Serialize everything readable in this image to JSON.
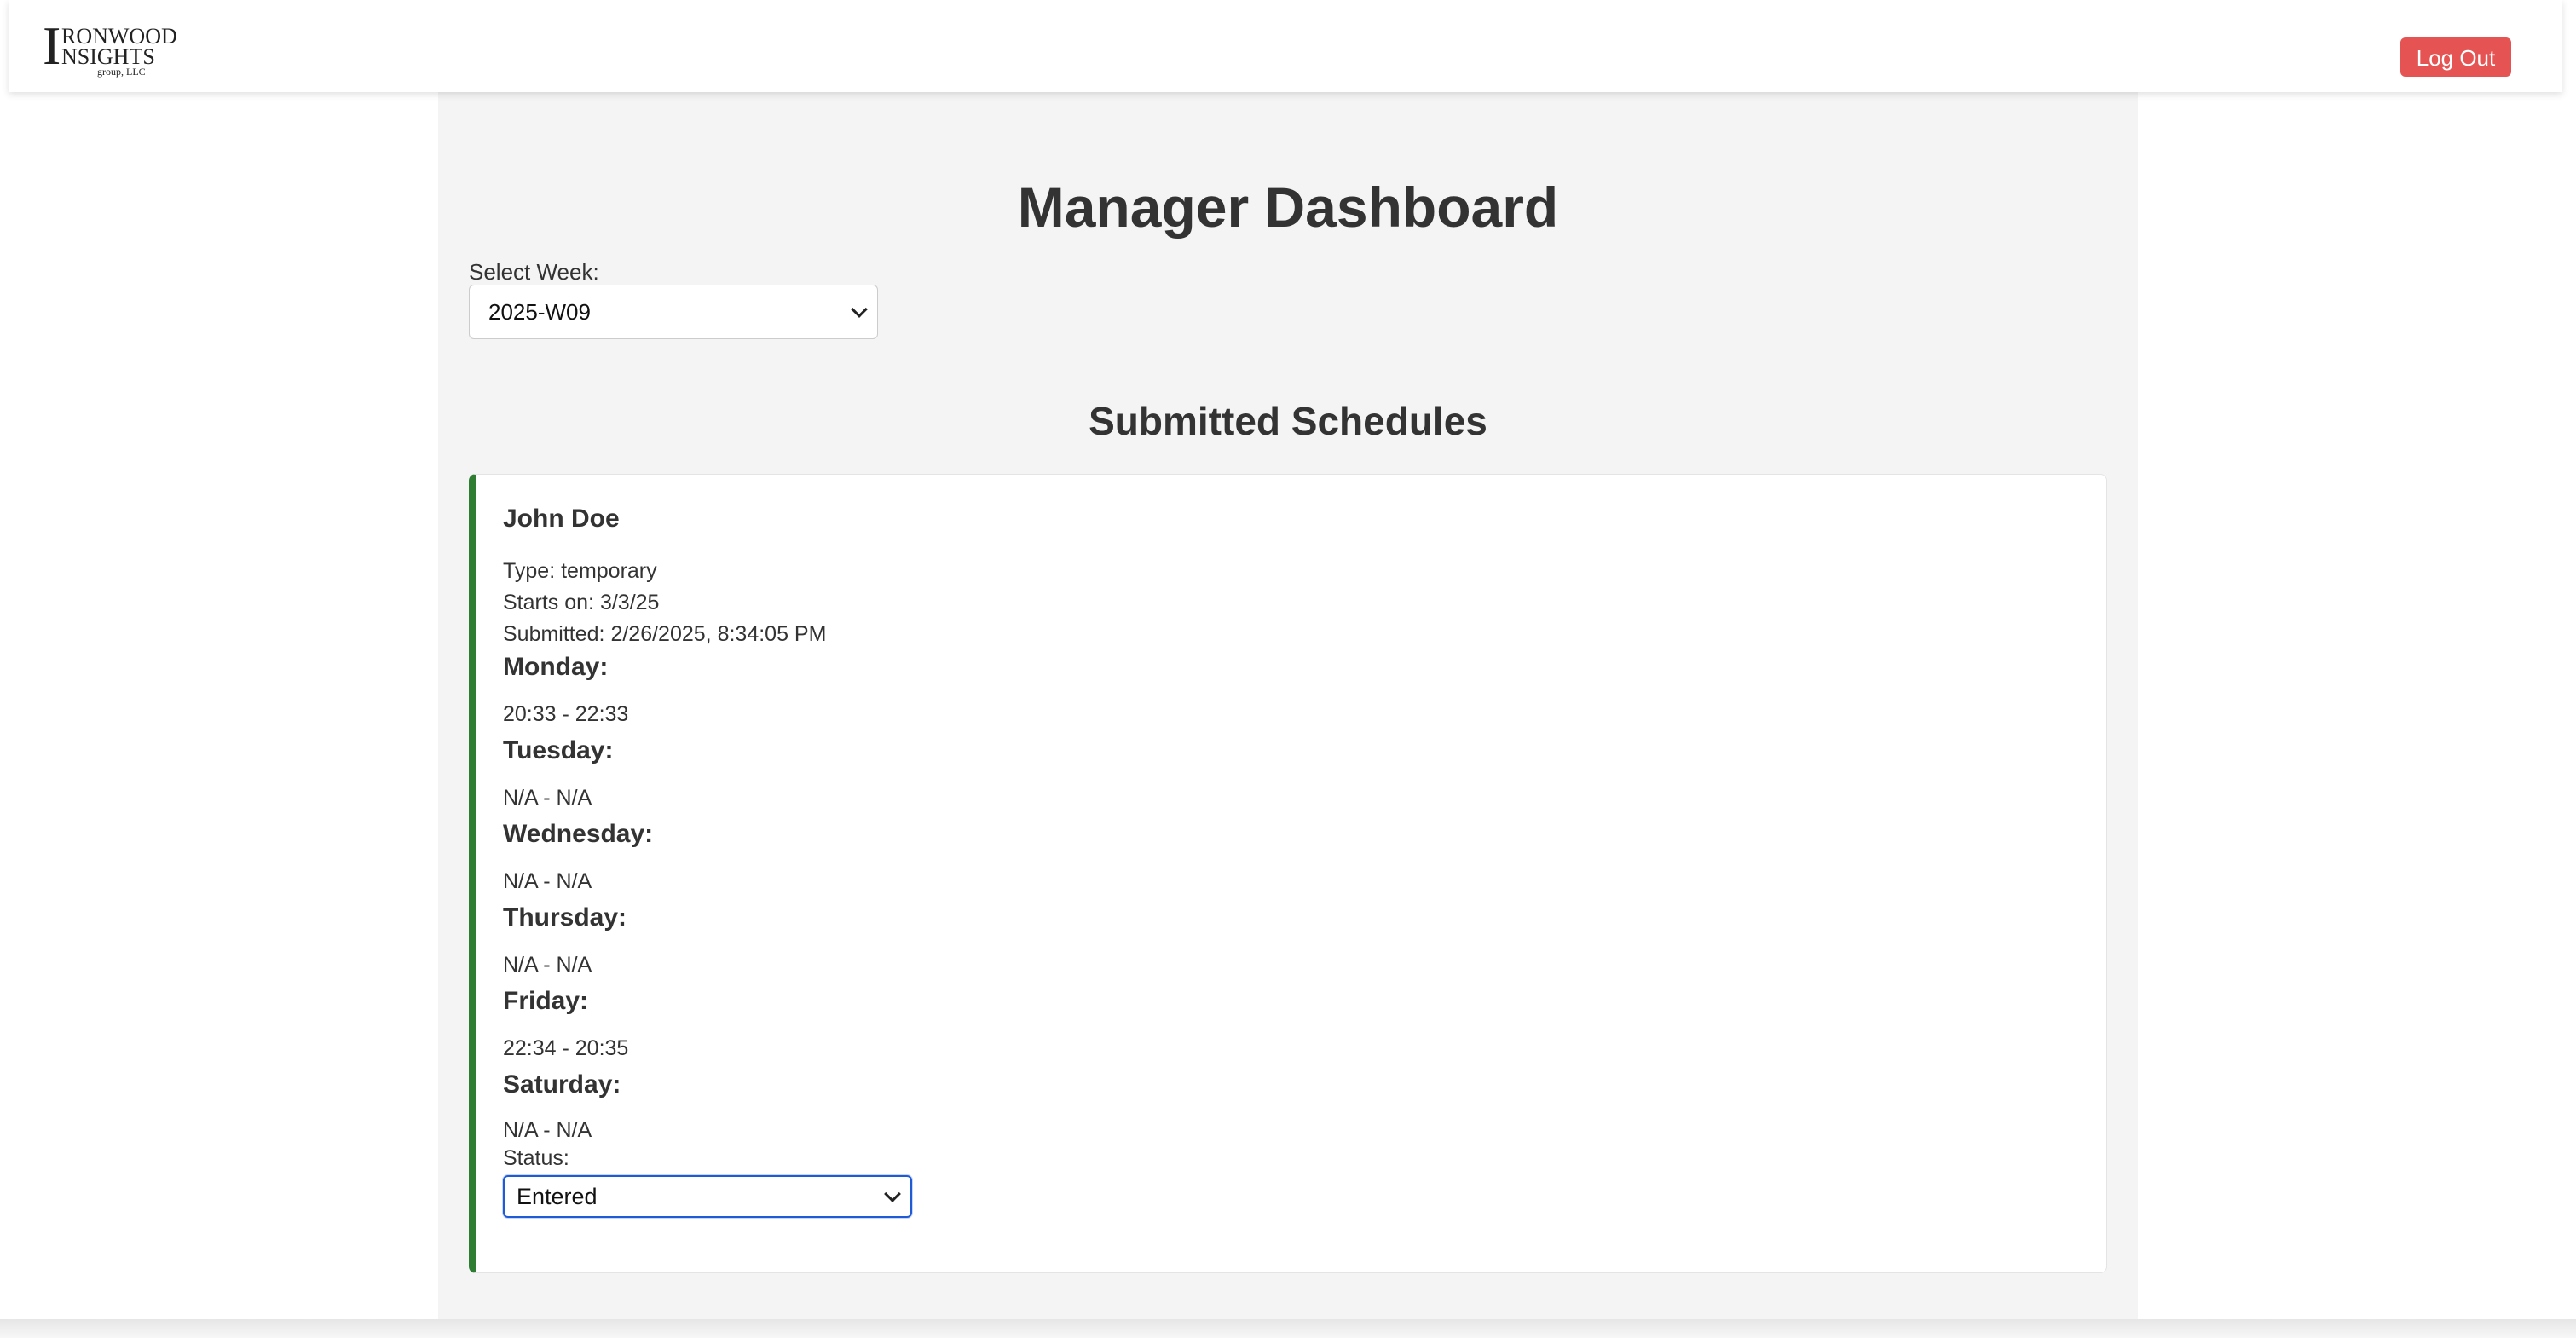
{
  "header": {
    "logo": {
      "line1": "RONWOOD",
      "line2": "NSIGHTS",
      "initial": "I",
      "line3": "group, LLC"
    },
    "logout_label": "Log Out",
    "logout_color": "#e55353"
  },
  "main": {
    "title": "Manager Dashboard",
    "week_selector": {
      "label": "Select Week:",
      "value": "2025-W09"
    },
    "section_title": "Submitted Schedules",
    "schedule": {
      "employee_name": "John Doe",
      "type": "Type: temporary",
      "starts_on": "Starts on: 3/3/25",
      "submitted": "Submitted: 2/26/2025, 8:34:05 PM",
      "accent_color": "#2e7d32",
      "days": [
        {
          "name": "Monday:",
          "hours": "20:33 - 22:33"
        },
        {
          "name": "Tuesday:",
          "hours": "N/A - N/A"
        },
        {
          "name": "Wednesday:",
          "hours": "N/A - N/A"
        },
        {
          "name": "Thursday:",
          "hours": "N/A - N/A"
        },
        {
          "name": "Friday:",
          "hours": "22:34 - 20:35"
        },
        {
          "name": "Saturday:",
          "hours": "N/A - N/A"
        }
      ],
      "status": {
        "label": "Status:",
        "value": "Entered"
      }
    }
  }
}
